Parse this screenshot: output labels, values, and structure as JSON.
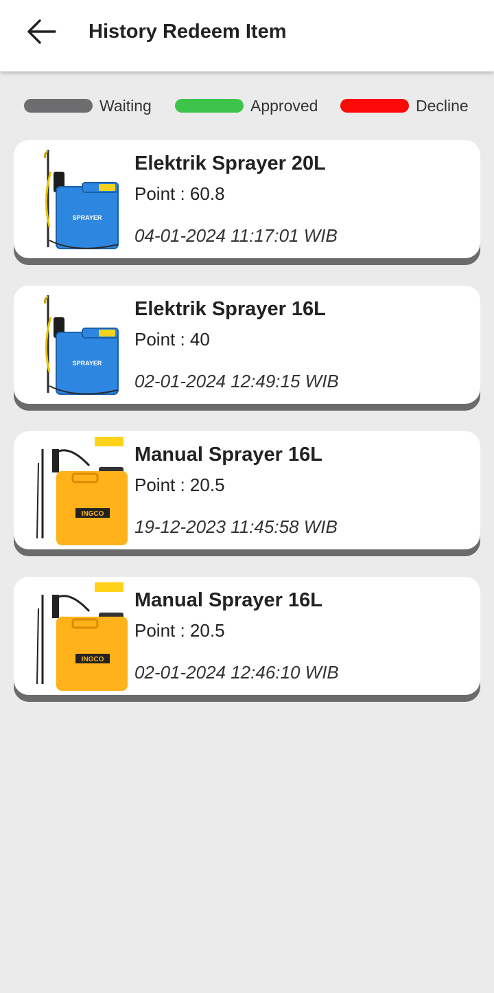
{
  "header": {
    "title": "History Redeem Item",
    "back_icon": "arrow-left-icon"
  },
  "legend": [
    {
      "label": "Waiting",
      "color": "#6d6d6f"
    },
    {
      "label": "Approved",
      "color": "#3ec44b"
    },
    {
      "label": "Decline",
      "color": "#fb0808"
    }
  ],
  "items": [
    {
      "name": "Elektrik Sprayer 20L",
      "point": "Point : 60.8",
      "date": "04-01-2024 11:17:01 WIB",
      "image": "blue-sprayer-image",
      "brand_text": "SPRAYER"
    },
    {
      "name": "Elektrik Sprayer 16L",
      "point": "Point : 40",
      "date": "02-01-2024 12:49:15 WIB",
      "image": "blue-sprayer-image",
      "brand_text": "SPRAYER"
    },
    {
      "name": "Manual Sprayer 16L",
      "point": "Point : 20.5",
      "date": "19-12-2023 11:45:58 WIB",
      "image": "yellow-sprayer-image",
      "brand_text": "INGCO"
    },
    {
      "name": "Manual Sprayer 16L",
      "point": "Point : 20.5",
      "date": "02-01-2024 12:46:10 WIB",
      "image": "yellow-sprayer-image",
      "brand_text": "INGCO"
    }
  ]
}
